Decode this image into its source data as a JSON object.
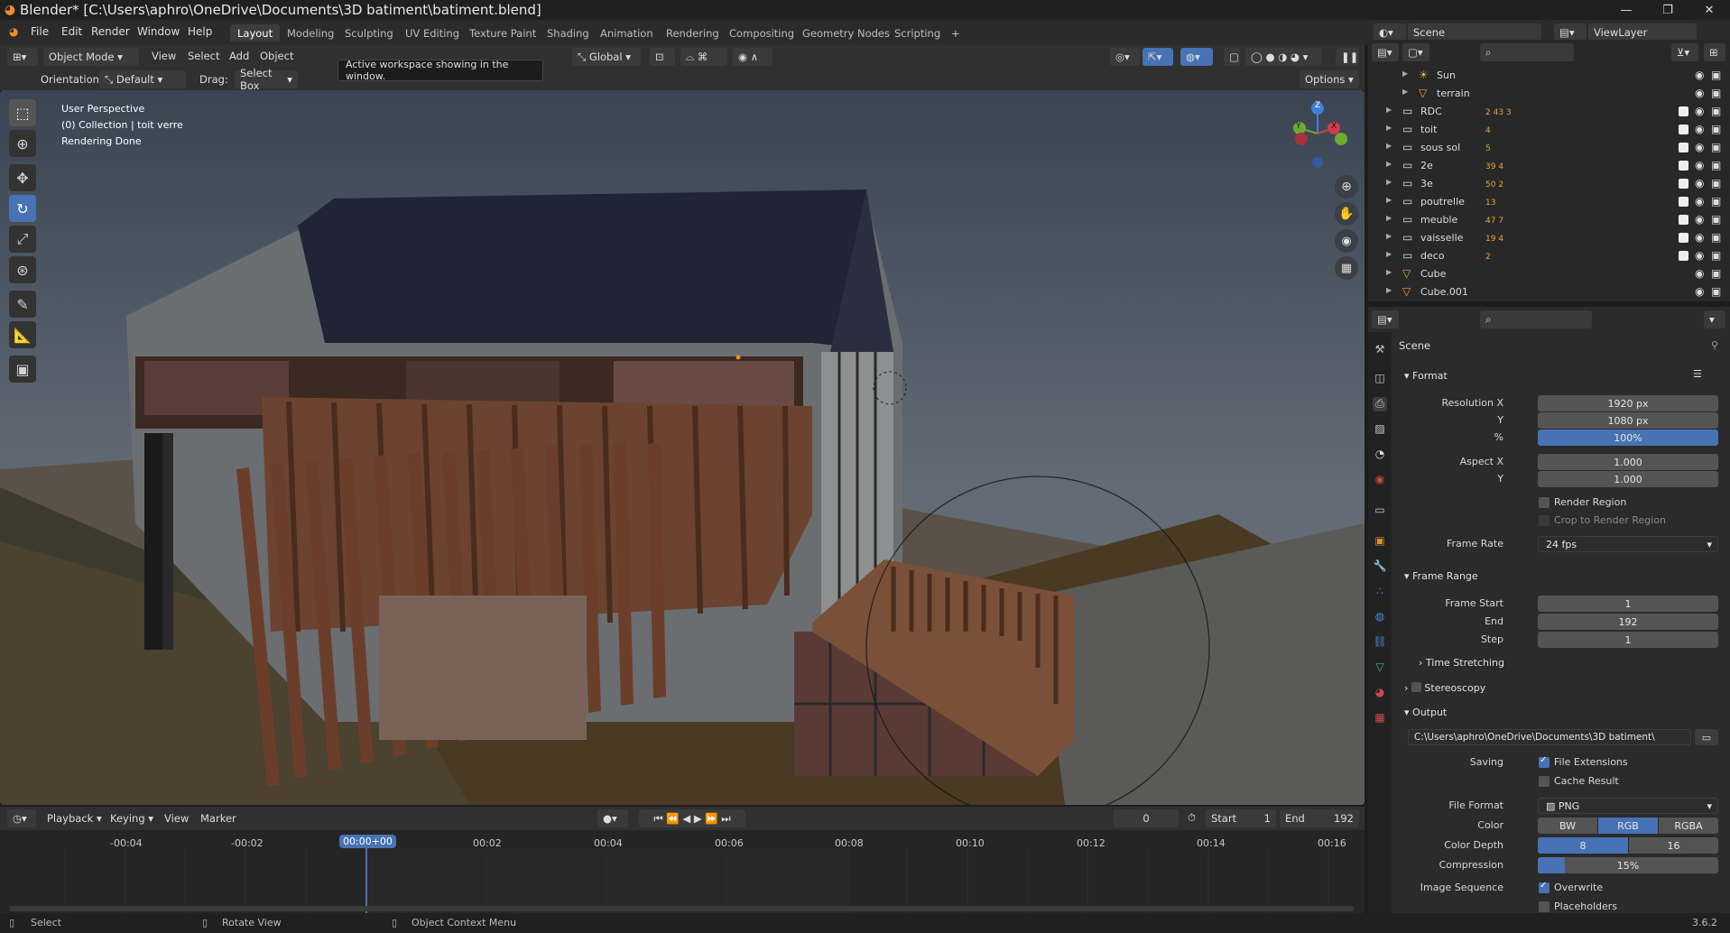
{
  "window": {
    "title": "Blender* [C:\\Users\\aphro\\OneDrive\\Documents\\3D batiment\\batiment.blend]",
    "minimize": "—",
    "maximize": "❐",
    "close": "✕"
  },
  "menubar": {
    "items": [
      "File",
      "Edit",
      "Render",
      "Window",
      "Help"
    ],
    "workspaces": [
      "Layout",
      "Modeling",
      "Sculpting",
      "UV Editing",
      "Texture Paint",
      "Shading",
      "Animation",
      "Rendering",
      "Compositing",
      "Geometry Nodes",
      "Scripting"
    ],
    "add_tab": "+",
    "scene": "Scene",
    "view_layer": "ViewLayer"
  },
  "viewport_header": {
    "mode": "Object Mode",
    "menus": [
      "View",
      "Select",
      "Add",
      "Object"
    ],
    "transform": "Global",
    "orientation_label": "Orientation:",
    "orientation_value": "Default",
    "drag_label": "Drag:",
    "drag_value": "Select Box",
    "options": "Options",
    "tooltip": "Active workspace showing in the window."
  },
  "viewport": {
    "overlay_lines": [
      "User Perspective",
      "(0) Collection | toit verre",
      "Rendering Done"
    ],
    "gizmo": {
      "x": "X",
      "y": "Y",
      "z": "Z"
    }
  },
  "outliner": {
    "items": [
      {
        "name": "Sun",
        "indent": 2,
        "type": "light"
      },
      {
        "name": "terrain",
        "indent": 2,
        "type": "mesh"
      },
      {
        "name": "RDC",
        "indent": 1,
        "type": "collection",
        "badges": "2 43 3"
      },
      {
        "name": "toit",
        "indent": 1,
        "type": "collection",
        "badges": "4"
      },
      {
        "name": "sous sol",
        "indent": 1,
        "type": "collection",
        "badges": "5"
      },
      {
        "name": "2e",
        "indent": 1,
        "type": "collection",
        "badges": "39 4"
      },
      {
        "name": "3e",
        "indent": 1,
        "type": "collection",
        "badges": "50 2"
      },
      {
        "name": "poutrelle",
        "indent": 1,
        "type": "collection",
        "badges": "13"
      },
      {
        "name": "meuble",
        "indent": 1,
        "type": "collection",
        "badges": "47 7"
      },
      {
        "name": "vaisselle",
        "indent": 1,
        "type": "collection",
        "badges": "19 4"
      },
      {
        "name": "deco",
        "indent": 1,
        "type": "collection",
        "badges": "2"
      },
      {
        "name": "Cube",
        "indent": 1,
        "type": "mesh",
        "badges": ""
      },
      {
        "name": "Cube.001",
        "indent": 1,
        "type": "mesh",
        "badges": ""
      }
    ]
  },
  "properties": {
    "context": "Scene",
    "format": {
      "header": "Format",
      "res_x_label": "Resolution X",
      "res_x": "1920 px",
      "res_y_label": "Y",
      "res_y": "1080 px",
      "pct_label": "%",
      "pct": "100%",
      "aspect_x_label": "Aspect X",
      "aspect_x": "1.000",
      "aspect_y_label": "Y",
      "aspect_y": "1.000",
      "render_region": "Render Region",
      "crop_region": "Crop to Render Region",
      "frame_rate_label": "Frame Rate",
      "frame_rate": "24 fps"
    },
    "frame_range": {
      "header": "Frame Range",
      "start_label": "Frame Start",
      "start": "1",
      "end_label": "End",
      "end": "192",
      "step_label": "Step",
      "step": "1",
      "time_stretching": "Time Stretching"
    },
    "stereoscopy": "Stereoscopy",
    "output": {
      "header": "Output",
      "path": "C:\\Users\\aphro\\OneDrive\\Documents\\3D batiment\\",
      "saving_label": "Saving",
      "file_extensions": "File Extensions",
      "cache_result": "Cache Result",
      "file_format_label": "File Format",
      "file_format": "PNG",
      "color_label": "Color",
      "color_options": [
        "BW",
        "RGB",
        "RGBA"
      ],
      "color_selected": "RGB",
      "depth_label": "Color Depth",
      "depth_options": [
        "8",
        "16"
      ],
      "depth_selected": "8",
      "compression_label": "Compression",
      "compression": "15%",
      "compression_value": 0.15,
      "image_seq_label": "Image Sequence",
      "overwrite": "Overwrite",
      "placeholders": "Placeholders"
    }
  },
  "timeline": {
    "menus": [
      "Playback",
      "Keying",
      "View",
      "Marker"
    ],
    "current_frame": "0",
    "start_label": "Start",
    "start": "1",
    "end_label": "End",
    "end": "192",
    "ticks": [
      "-00:04",
      "-00:02",
      "00:00+00",
      "00:02",
      "00:04",
      "00:06",
      "00:08",
      "00:10",
      "00:12",
      "00:14",
      "00:16"
    ]
  },
  "statusbar": {
    "items": [
      "Select",
      "Rotate View",
      "Object Context Menu"
    ],
    "version": "3.6.2"
  },
  "colors": {
    "accent": "#4772b3",
    "orange": "#f08c2a",
    "roof": "#1f2436",
    "wood": "#6b4330"
  }
}
